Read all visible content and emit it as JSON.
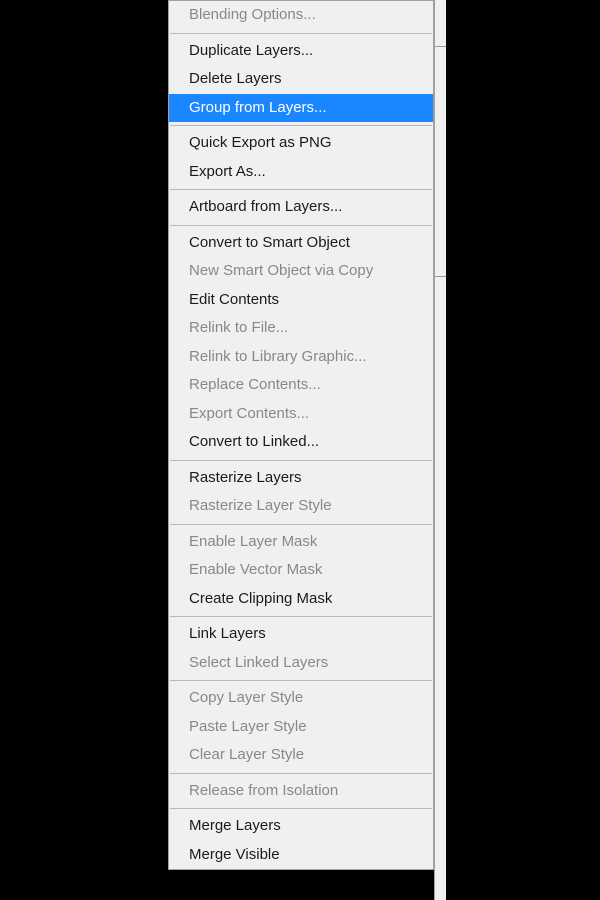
{
  "menu": {
    "groups": [
      [
        {
          "label": "Blending Options...",
          "disabled": true,
          "highlighted": false
        }
      ],
      [
        {
          "label": "Duplicate Layers...",
          "disabled": false,
          "highlighted": false
        },
        {
          "label": "Delete Layers",
          "disabled": false,
          "highlighted": false
        },
        {
          "label": "Group from Layers...",
          "disabled": false,
          "highlighted": true
        }
      ],
      [
        {
          "label": "Quick Export as PNG",
          "disabled": false,
          "highlighted": false
        },
        {
          "label": "Export As...",
          "disabled": false,
          "highlighted": false
        }
      ],
      [
        {
          "label": "Artboard from Layers...",
          "disabled": false,
          "highlighted": false
        }
      ],
      [
        {
          "label": "Convert to Smart Object",
          "disabled": false,
          "highlighted": false
        },
        {
          "label": "New Smart Object via Copy",
          "disabled": true,
          "highlighted": false
        },
        {
          "label": "Edit Contents",
          "disabled": false,
          "highlighted": false
        },
        {
          "label": "Relink to File...",
          "disabled": true,
          "highlighted": false
        },
        {
          "label": "Relink to Library Graphic...",
          "disabled": true,
          "highlighted": false
        },
        {
          "label": "Replace Contents...",
          "disabled": true,
          "highlighted": false
        },
        {
          "label": "Export Contents...",
          "disabled": true,
          "highlighted": false
        },
        {
          "label": "Convert to Linked...",
          "disabled": false,
          "highlighted": false
        }
      ],
      [
        {
          "label": "Rasterize Layers",
          "disabled": false,
          "highlighted": false
        },
        {
          "label": "Rasterize Layer Style",
          "disabled": true,
          "highlighted": false
        }
      ],
      [
        {
          "label": "Enable Layer Mask",
          "disabled": true,
          "highlighted": false
        },
        {
          "label": "Enable Vector Mask",
          "disabled": true,
          "highlighted": false
        },
        {
          "label": "Create Clipping Mask",
          "disabled": false,
          "highlighted": false
        }
      ],
      [
        {
          "label": "Link Layers",
          "disabled": false,
          "highlighted": false
        },
        {
          "label": "Select Linked Layers",
          "disabled": true,
          "highlighted": false
        }
      ],
      [
        {
          "label": "Copy Layer Style",
          "disabled": true,
          "highlighted": false
        },
        {
          "label": "Paste Layer Style",
          "disabled": true,
          "highlighted": false
        },
        {
          "label": "Clear Layer Style",
          "disabled": true,
          "highlighted": false
        }
      ],
      [
        {
          "label": "Release from Isolation",
          "disabled": true,
          "highlighted": false
        }
      ],
      [
        {
          "label": "Merge Layers",
          "disabled": false,
          "highlighted": false
        },
        {
          "label": "Merge Visible",
          "disabled": false,
          "highlighted": false
        }
      ]
    ]
  }
}
